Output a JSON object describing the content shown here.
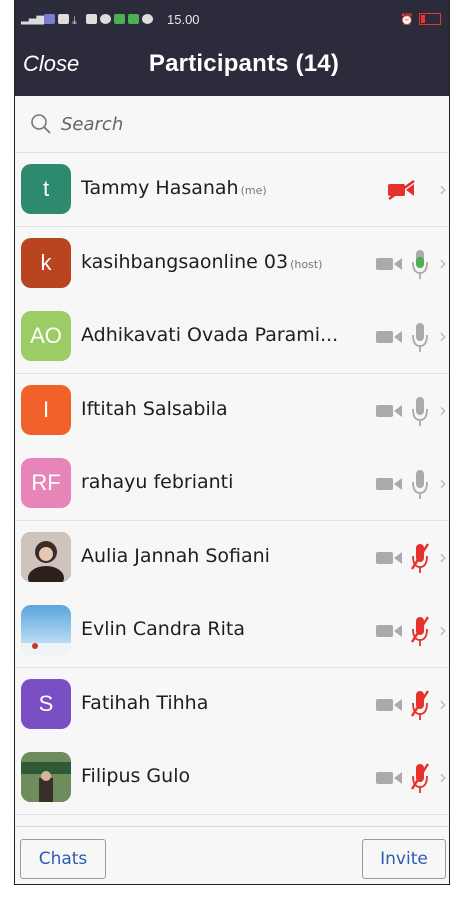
{
  "status_bar": {
    "time": "15.00"
  },
  "header": {
    "close_label": "Close",
    "title": "Participants (14)"
  },
  "search": {
    "placeholder": "Search"
  },
  "participants": [
    {
      "name": "Tammy Hasanah",
      "tag": "(me)",
      "initials": "t",
      "avatar_color": "#2e8a6e",
      "video": "off-red",
      "mic": "none"
    },
    {
      "name": "kasihbangsaonline 03",
      "tag": "(host)",
      "initials": "k",
      "avatar_color": "#b8451f",
      "video": "off",
      "mic": "active-green"
    },
    {
      "name": "Adhikavati Ovada Parami...",
      "tag": "",
      "initials": "AO",
      "avatar_color": "#9ccc65",
      "video": "off",
      "mic": "on"
    },
    {
      "name": "Iftitah Salsabila",
      "tag": "",
      "initials": "I",
      "avatar_color": "#f0622a",
      "video": "off",
      "mic": "on"
    },
    {
      "name": "rahayu febrianti",
      "tag": "",
      "initials": "RF",
      "avatar_color": "#e784b8",
      "video": "off",
      "mic": "on"
    },
    {
      "name": "Aulia Jannah Sofiani",
      "tag": "",
      "initials": "",
      "avatar_color": "#6b5a52",
      "video": "off",
      "mic": "muted"
    },
    {
      "name": "Evlin Candra Rita",
      "tag": "",
      "initials": "",
      "avatar_color": "#8ec4e6",
      "video": "off",
      "mic": "muted"
    },
    {
      "name": "Fatihah Tihha",
      "tag": "",
      "initials": "S",
      "avatar_color": "#7b4fc4",
      "video": "off",
      "mic": "muted"
    },
    {
      "name": "Filipus Gulo",
      "tag": "",
      "initials": "",
      "avatar_color": "#4f7a56",
      "video": "off",
      "mic": "muted"
    }
  ],
  "footer": {
    "chats_label": "Chats",
    "invite_label": "Invite"
  },
  "colors": {
    "header_bg": "#2b2b3c",
    "accent_blue": "#2a5db0",
    "muted_red": "#e5302b",
    "active_green": "#4caf50",
    "icon_gray": "#a9a9ae"
  }
}
